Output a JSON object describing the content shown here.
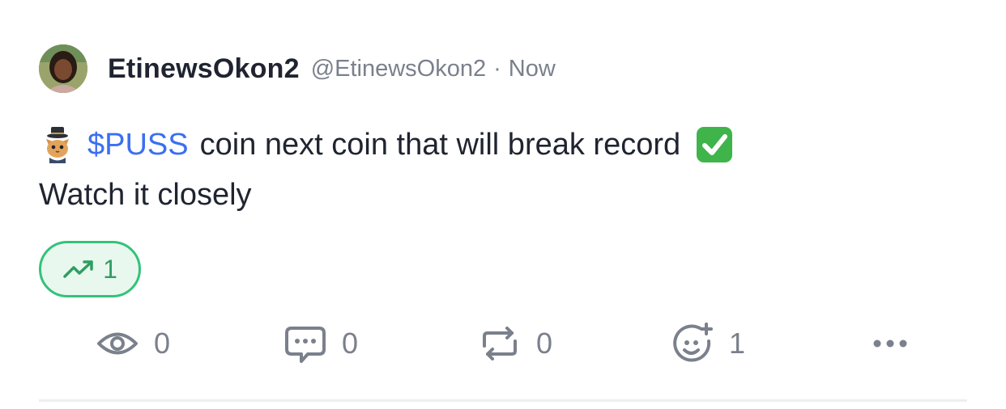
{
  "post": {
    "author": {
      "display_name": "EtinewsOkon2",
      "handle": "@EtinewsOkon2",
      "time": "Now"
    },
    "separator": "·",
    "text": {
      "cashtag": "$PUSS",
      "line1_rest": "coin next coin that will break record",
      "line2": "Watch it closely"
    },
    "trend_chip": {
      "count": "1",
      "icon": "trending-up-icon"
    },
    "actions": {
      "views": {
        "icon": "eye-icon",
        "count": "0"
      },
      "comments": {
        "icon": "comment-icon",
        "count": "0"
      },
      "reposts": {
        "icon": "repost-icon",
        "count": "0"
      },
      "reactions": {
        "icon": "add-reaction-icon",
        "count": "1"
      },
      "more": {
        "icon": "more-icon"
      }
    }
  },
  "colors": {
    "text": "#1f2430",
    "muted": "#7a808c",
    "link": "#3b6ff2",
    "trend_border": "#34c27a",
    "trend_bg": "#e9f8ef"
  }
}
